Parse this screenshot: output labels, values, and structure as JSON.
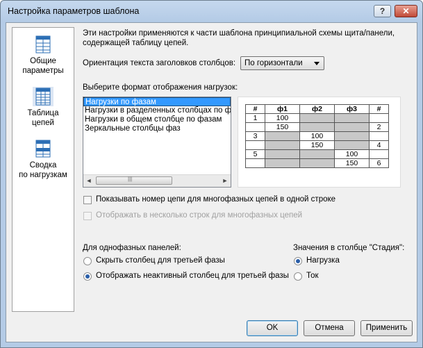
{
  "window": {
    "title": "Настройка параметров шаблона",
    "help_glyph": "?",
    "close_glyph": "✕"
  },
  "nav": [
    {
      "label_line1": "Общие",
      "label_line2": "параметры"
    },
    {
      "label_line1": "Таблица",
      "label_line2": "цепей"
    },
    {
      "label_line1": "Сводка",
      "label_line2": "по нагрузкам"
    }
  ],
  "intro": {
    "line1": "Эти настройки применяются к части шаблона принципиальной схемы щита/панели,",
    "line2": "содержащей таблицу цепей."
  },
  "orientation": {
    "label": "Ориентация текста заголовков столбцов:",
    "value": "По горизонтали"
  },
  "load_format": {
    "label": "Выберите формат отображения нагрузок:",
    "options": [
      "Нагрузки по фазам",
      "Нагрузки в разделенных столбцах по фаз",
      "Нагрузки в общем столбце по фазам",
      "Зеркальные столбцы фаз"
    ],
    "selected_index": 0
  },
  "preview": {
    "headers": [
      "#",
      "ф1",
      "ф2",
      "ф3",
      "#"
    ],
    "rows": [
      [
        "1",
        "100",
        "",
        "",
        ""
      ],
      [
        "",
        "150",
        "",
        "",
        "2"
      ],
      [
        "3",
        "",
        "100",
        "",
        ""
      ],
      [
        "",
        "",
        "150",
        "",
        "4"
      ],
      [
        "5",
        "",
        "",
        "100",
        ""
      ],
      [
        "",
        "",
        "",
        "150",
        "6"
      ]
    ]
  },
  "checkboxes": {
    "show_circuit": {
      "label": "Показывать номер цепи для многофазных цепей в одной строке",
      "checked": false
    },
    "multi_rows": {
      "label": "Отображать в несколько строк для многофазных цепей",
      "checked": false,
      "disabled": true
    }
  },
  "single_phase": {
    "label": "Для однофазных панелей:",
    "options": [
      "Скрыть столбец для третьей фазы",
      "Отображать неактивный столбец для третьей фазы"
    ],
    "selected_index": 1
  },
  "stage": {
    "label": "Значения в столбце \"Стадия\":",
    "options": [
      "Нагрузка",
      "Ток"
    ],
    "selected_index": 0
  },
  "buttons": {
    "ok": "OK",
    "cancel": "Отмена",
    "apply": "Применить"
  },
  "scroll": {
    "left": "◄",
    "right": "►",
    "grip": "|||"
  }
}
